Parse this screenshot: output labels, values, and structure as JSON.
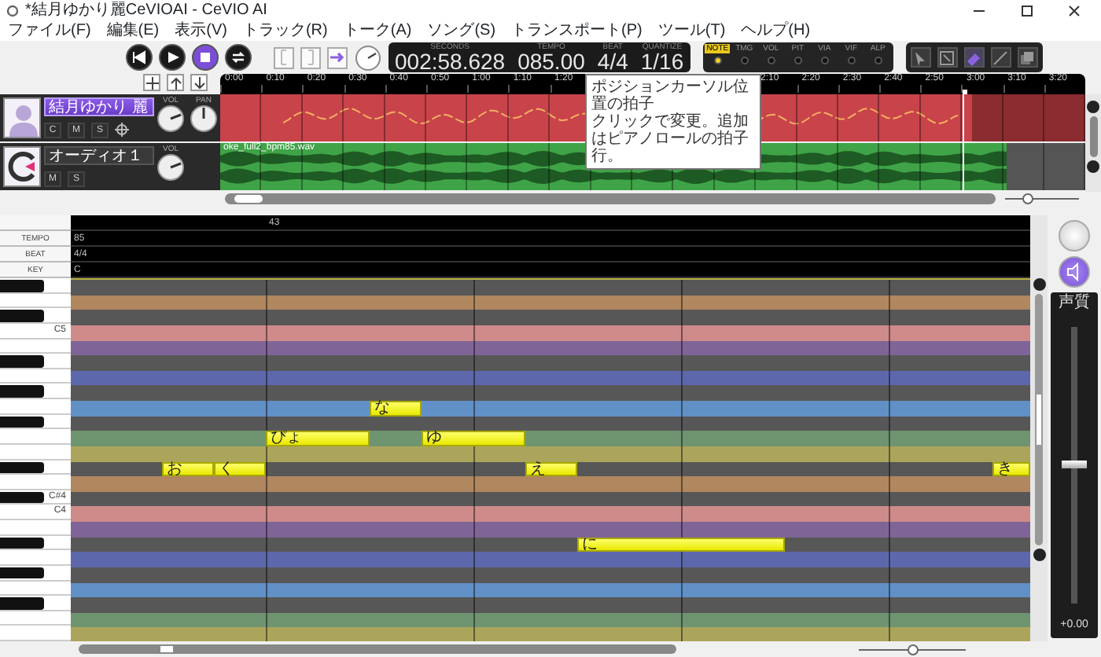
{
  "window": {
    "title": "*結月ゆかり麗CeVIOAI - CeVIO AI"
  },
  "menu": [
    "ファイル(F)",
    "編集(E)",
    "表示(V)",
    "トラック(R)",
    "トーク(A)",
    "ソング(S)",
    "トランスポート(P)",
    "ツール(T)",
    "ヘルプ(H)"
  ],
  "transport": [
    {
      "kind": "rewind",
      "selected": false
    },
    {
      "kind": "play",
      "selected": false
    },
    {
      "kind": "stop",
      "selected": true
    },
    {
      "kind": "loop",
      "selected": false
    }
  ],
  "display": [
    {
      "label": "SECONDS",
      "value": "002:58.628"
    },
    {
      "label": "TEMPO",
      "value": "085.00"
    },
    {
      "label": "BEAT",
      "value": "4/4"
    },
    {
      "label": "QUANTIZE",
      "value": "1/16"
    }
  ],
  "parameters": [
    {
      "label": "NOTE",
      "selected": true
    },
    {
      "label": "TMG",
      "selected": false
    },
    {
      "label": "VOL",
      "selected": false
    },
    {
      "label": "PIT",
      "selected": false
    },
    {
      "label": "VIA",
      "selected": false
    },
    {
      "label": "VIF",
      "selected": false
    },
    {
      "label": "ALP",
      "selected": false
    }
  ],
  "tools": [
    {
      "kind": "pointer",
      "selected": false
    },
    {
      "kind": "range",
      "selected": false
    },
    {
      "kind": "eraser",
      "selected": true
    },
    {
      "kind": "line",
      "selected": false
    },
    {
      "kind": "copy",
      "selected": false
    }
  ],
  "tooltip": {
    "lines": [
      "ポジションカーソル位置の拍子",
      "クリックで変更。追加はピアノロールの拍子行。"
    ]
  },
  "ruler": {
    "left": [
      "0:00",
      "0:10",
      "0:20",
      "0:30",
      "0:40",
      "0:50",
      "1:00",
      "1:10",
      "1:20"
    ],
    "right": [
      "2:10",
      "2:20",
      "2:30",
      "2:40",
      "2:50",
      "3:00",
      "3:10",
      "3:20"
    ]
  },
  "track_zoom": {
    "level": 0.3
  },
  "tracks": [
    {
      "kind": "voice",
      "name": "結月ゆかり 麗",
      "selected": true,
      "buttons": [
        "C",
        "M",
        "S"
      ],
      "knobs": [
        {
          "label": "VOL"
        },
        {
          "label": "PAN"
        }
      ]
    },
    {
      "kind": "audio",
      "name": "オーディオ１",
      "selected": false,
      "buttons": [
        "M",
        "S"
      ],
      "knobs": [
        {
          "label": "VOL"
        }
      ],
      "clip": "oke_full2_bpm85.wav"
    }
  ],
  "piano_roll": {
    "header": [
      {
        "label": "TEMPO",
        "value": "85"
      },
      {
        "label": "BEAT",
        "value": "4/4"
      },
      {
        "label": "KEY",
        "value": "C"
      }
    ],
    "measure": "43",
    "key_labels": [
      "C5",
      "C#4",
      "C4"
    ],
    "notes": [
      {
        "lyric": "お"
      },
      {
        "lyric": "く"
      },
      {
        "lyric": "ぴょ"
      },
      {
        "lyric": "な"
      },
      {
        "lyric": "ゆ"
      },
      {
        "lyric": "え"
      },
      {
        "lyric": "に"
      },
      {
        "lyric": "き"
      }
    ],
    "zoom": {
      "level": 0.5
    }
  },
  "volume": {
    "label": "声質",
    "level": 0.5,
    "reading": "+0.00"
  }
}
